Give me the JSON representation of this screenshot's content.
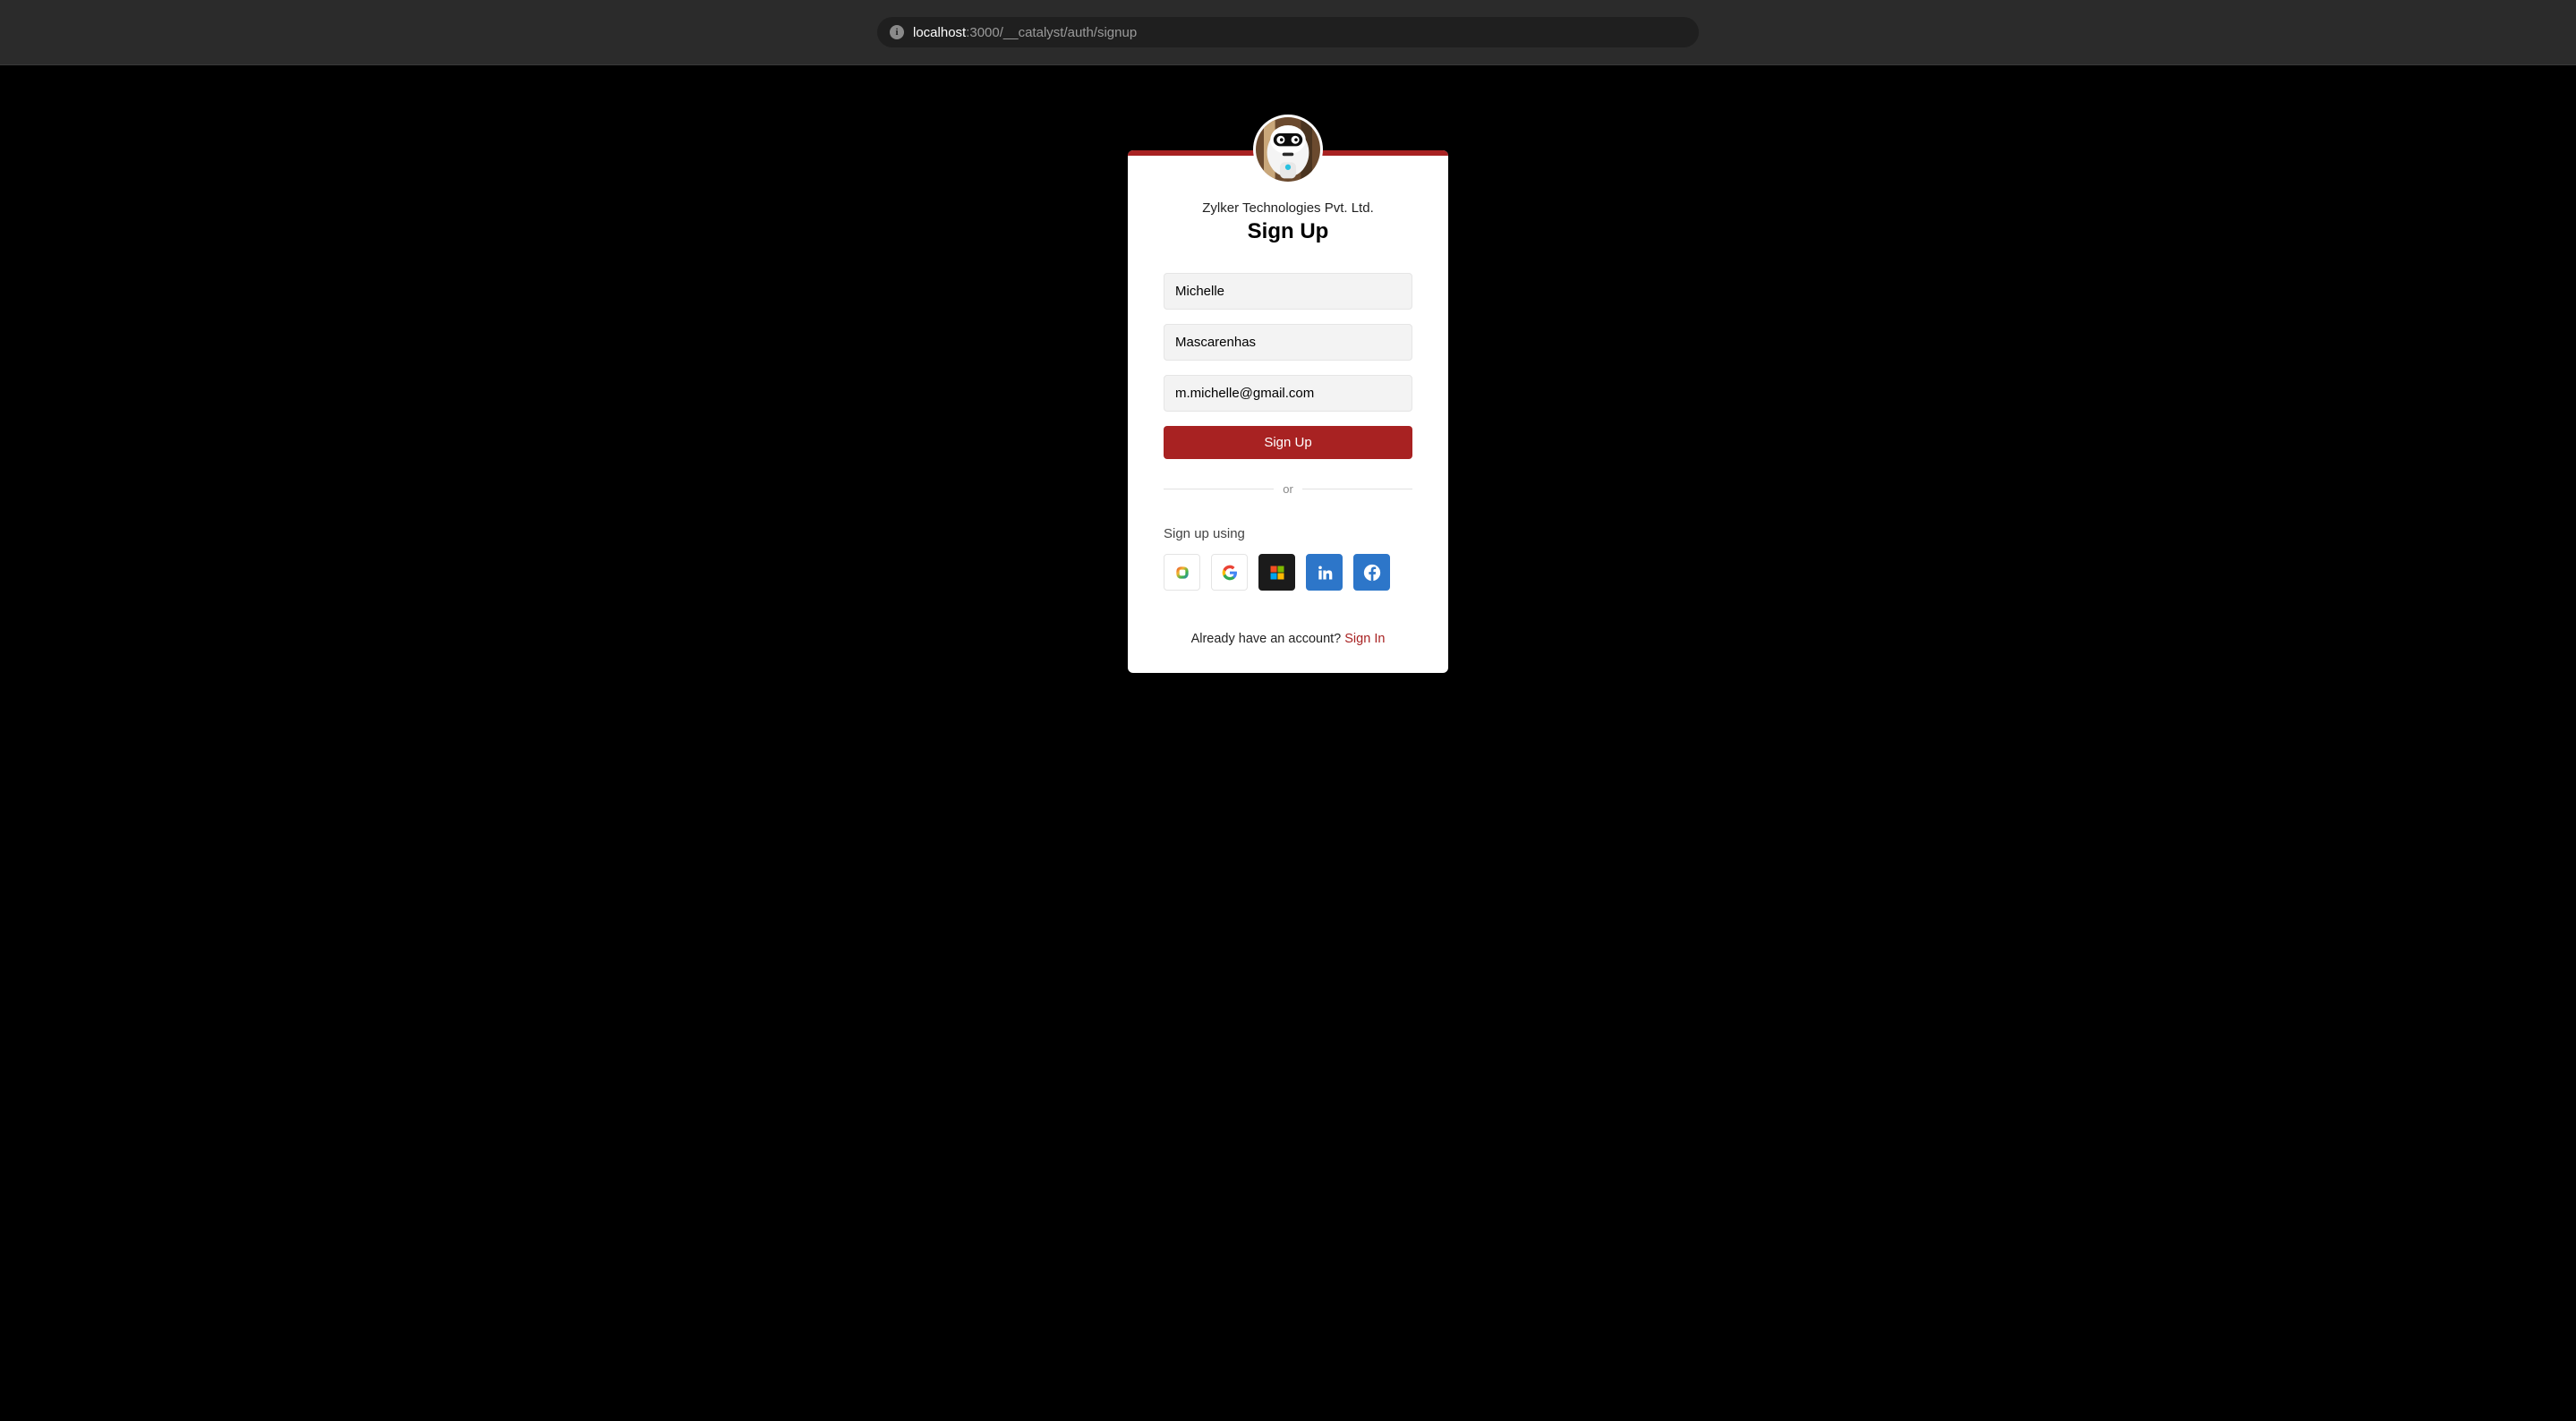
{
  "browser": {
    "url_host": "localhost",
    "url_path": ":3000/__catalyst/auth/signup"
  },
  "card": {
    "accent_color": "#a82222",
    "company_name": "Zylker Technologies Pvt. Ltd.",
    "title": "Sign Up"
  },
  "form": {
    "first_name": "Michelle",
    "last_name": "Mascarenhas",
    "email": "m.michelle@gmail.com",
    "submit_label": "Sign Up"
  },
  "divider": {
    "text": "or"
  },
  "social": {
    "label": "Sign up using",
    "providers": [
      {
        "name": "zoho",
        "icon": "zoho-icon"
      },
      {
        "name": "google",
        "icon": "google-icon"
      },
      {
        "name": "microsoft",
        "icon": "microsoft-icon"
      },
      {
        "name": "linkedin",
        "icon": "linkedin-icon"
      },
      {
        "name": "facebook",
        "icon": "facebook-icon"
      }
    ]
  },
  "footer": {
    "prompt": "Already have an account? ",
    "link_label": "Sign In"
  }
}
